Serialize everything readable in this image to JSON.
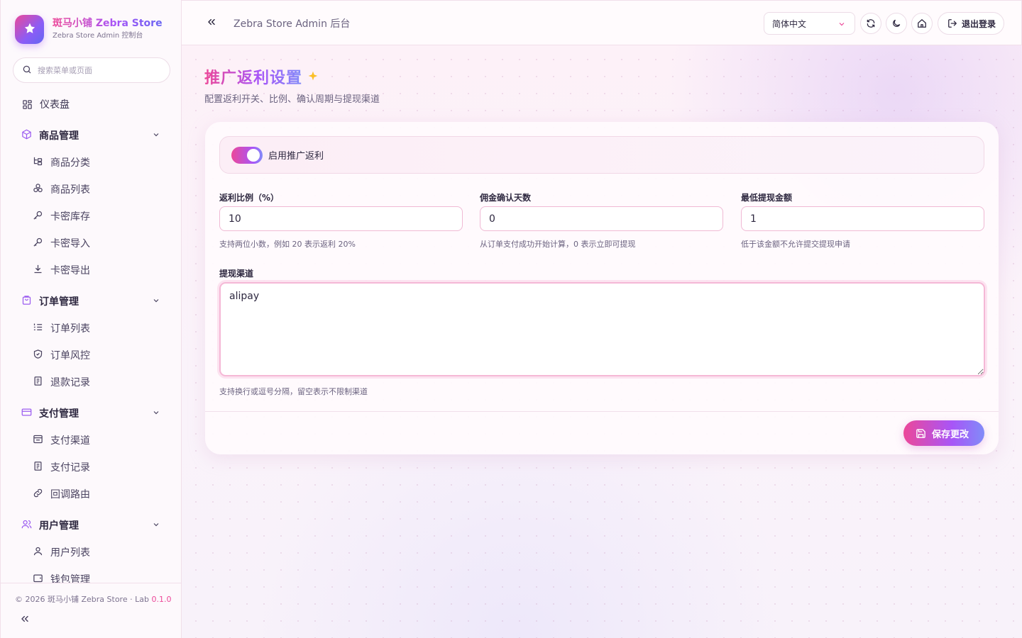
{
  "brand": {
    "title": "斑马小铺 Zebra Store",
    "subtitle": "Zebra Store Admin 控制台"
  },
  "search": {
    "placeholder": "搜索菜单或页面"
  },
  "nav": {
    "dashboard": "仪表盘",
    "groups": [
      {
        "label": "商品管理",
        "items": [
          "商品分类",
          "商品列表",
          "卡密库存",
          "卡密导入",
          "卡密导出"
        ]
      },
      {
        "label": "订单管理",
        "items": [
          "订单列表",
          "订单风控",
          "退款记录"
        ]
      },
      {
        "label": "支付管理",
        "items": [
          "支付渠道",
          "支付记录",
          "回调路由"
        ]
      },
      {
        "label": "用户管理",
        "items": [
          "用户列表",
          "钱包管理"
        ]
      }
    ]
  },
  "footer": {
    "copyright": "© 2026 斑马小铺 Zebra Store · Lab ",
    "version": "0.1.0"
  },
  "header": {
    "title": "Zebra Store Admin 后台",
    "language": "简体中文",
    "logout": "退出登录"
  },
  "page": {
    "title": "推广返利设置",
    "subtitle": "配置返利开关、比例、确认周期与提现渠道"
  },
  "form": {
    "enable_label": "启用推广返利",
    "enabled": true,
    "rate": {
      "label": "返利比例（%）",
      "value": "10",
      "hint": "支持两位小数，例如 20 表示返利 20%"
    },
    "confirm_days": {
      "label": "佣金确认天数",
      "value": "0",
      "hint": "从订单支付成功开始计算，0 表示立即可提现"
    },
    "min_withdraw": {
      "label": "最低提现金额",
      "value": "1",
      "hint": "低于该金额不允许提交提现申请"
    },
    "channels": {
      "label": "提现渠道",
      "value": "alipay",
      "hint": "支持换行或逗号分隔，留空表示不限制渠道"
    },
    "save": "保存更改"
  },
  "colors": {
    "accent_pink": "#ec4899",
    "accent_purple": "#a855f7",
    "accent_indigo": "#818cf8"
  },
  "icons": {
    "brand": "sparkle-star-icon",
    "dashboard": "grid-icon",
    "product_group": "cube-icon",
    "order_group": "shopping-bag-icon",
    "payment_group": "credit-card-icon",
    "user_group": "users-icon"
  }
}
